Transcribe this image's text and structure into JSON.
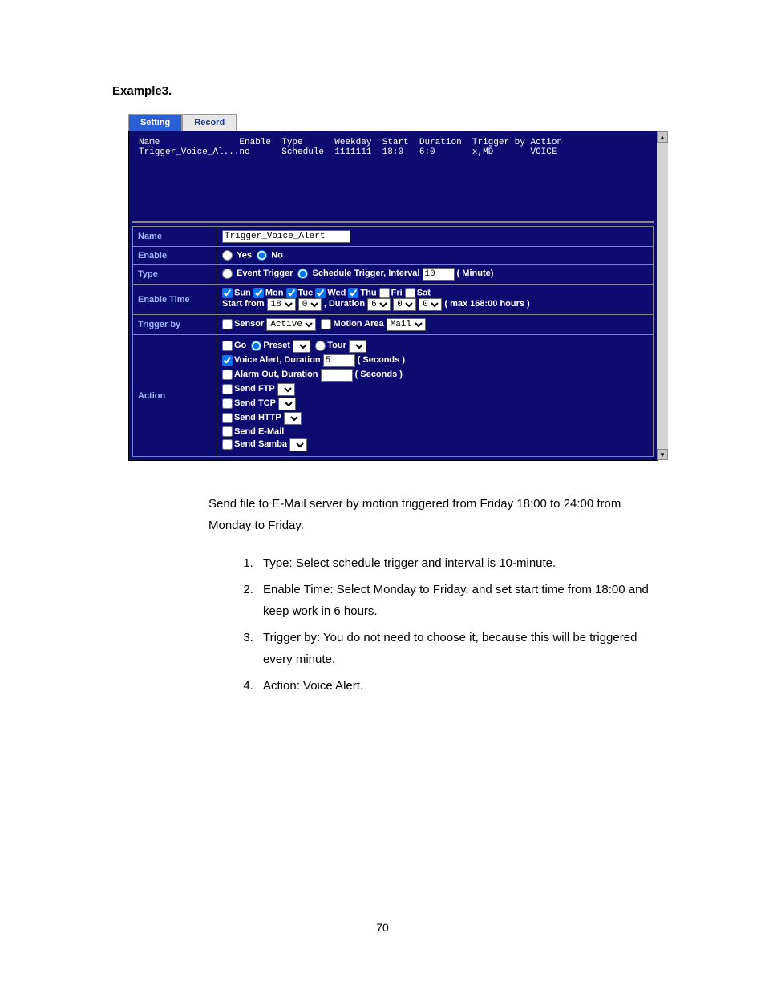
{
  "heading": "Example3.",
  "tabs": {
    "setting": "Setting",
    "record": "Record"
  },
  "list": {
    "header": "Name               Enable  Type      Weekday  Start  Duration  Trigger by Action",
    "row": "Trigger_Voice_Al...no      Schedule  1111111  18:0   6:0       x,MD       VOICE"
  },
  "labels": {
    "name": "Name",
    "enable": "Enable",
    "type": "Type",
    "enable_time": "Enable Time",
    "trigger_by": "Trigger by",
    "action": "Action"
  },
  "form": {
    "name_value": "Trigger_Voice_Alert",
    "yes": "Yes",
    "no": "No",
    "event_trigger": "Event Trigger",
    "schedule_trigger": "Schedule Trigger, Interval",
    "interval_value": "10",
    "minute": "( Minute)",
    "days": {
      "sun": "Sun",
      "mon": "Mon",
      "tue": "Tue",
      "wed": "Wed",
      "thu": "Thu",
      "fri": "Fri",
      "sat": "Sat"
    },
    "start_from": "Start from",
    "start_hour": "18",
    "start_min": "0",
    "duration_lbl": ", Duration",
    "dur_h": "6",
    "dur_m": "0",
    "dur_s": "0",
    "max_hours": "( max 168:00 hours )",
    "sensor": "Sensor",
    "sensor_val": "Active",
    "motion_area": "Motion Area",
    "motion_val": "Mail",
    "go": "Go",
    "preset": "Preset",
    "tour": "Tour",
    "voice_alert": "Voice Alert, Duration",
    "voice_dur": "5",
    "seconds": "( Seconds )",
    "alarm_out": "Alarm Out, Duration",
    "send_ftp": "Send FTP",
    "send_tcp": "Send TCP",
    "send_http": "Send HTTP",
    "send_email": "Send E-Mail",
    "send_samba": "Send Samba"
  },
  "body": {
    "intro": "Send file to E-Mail server by motion triggered from Friday 18:00 to 24:00 from Monday to Friday.",
    "items": [
      "Type: Select schedule trigger and interval is 10-minute.",
      "Enable Time: Select Monday to Friday, and set start time from 18:00 and keep work in 6 hours.",
      "Trigger by: You do not need to choose it, because this will be triggered every minute.",
      "Action: Voice Alert."
    ]
  },
  "page_number": "70"
}
